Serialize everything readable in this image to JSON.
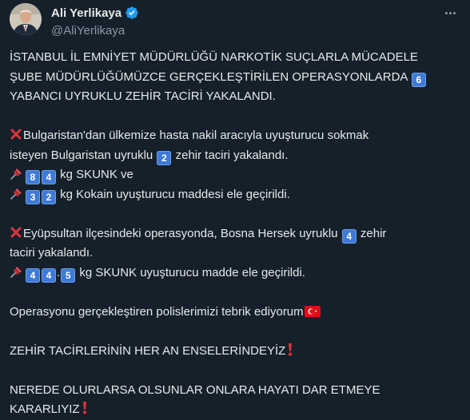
{
  "author": {
    "display_name": "Ali Yerlikaya",
    "handle": "@AliYerlikaya"
  },
  "icons": {
    "verified": "verified-badge-icon",
    "more": "more-options-icon",
    "x_mark": "red-cross-mark-icon",
    "pin": "pushpin-icon",
    "flag": "turkey-flag-icon",
    "exclamation": "red-exclamation-icon"
  },
  "colors": {
    "background": "#15202b",
    "text": "#e7e9ea",
    "muted": "#8b98a5",
    "verified": "#1d9bf0",
    "keycap": "#3f7ad6",
    "red": "#e0343a"
  },
  "tweet": {
    "p1": {
      "l1": "İSTANBUL İL EMNİYET MÜDÜRLÜĞÜ NARKOTİK SUÇLARLA MÜCADELE",
      "l2a": "ŞUBE MÜDÜRLÜĞÜMÜZCE GERÇEKLEŞTİRİLEN OPERASYONLARDA",
      "l2n": "6",
      "l3": "YABANCI UYRUKLU ZEHİR TACİRİ YAKALANDI."
    },
    "p2": {
      "l1": "Bulgaristan'dan ülkemize hasta nakil aracıyla uyuşturucu sokmak",
      "l2a": "isteyen Bulgaristan uyruklu",
      "l2n": "2",
      "l2b": "zehir taciri yakalandı.",
      "l3n1": "8",
      "l3n2": "4",
      "l3": "kg SKUNK ve",
      "l4n1": "3",
      "l4n2": "2",
      "l4": "kg Kokain uyuşturucu maddesi ele geçirildi."
    },
    "p3": {
      "l1a": "Eyüpsultan ilçesindeki operasyonda, Bosna Hersek uyruklu",
      "l1n": "4",
      "l1b": "zehir",
      "l2": "taciri yakalandı.",
      "l3n1": "4",
      "l3n2": "4",
      "l3dot": ".",
      "l3n3": "5",
      "l3": "kg SKUNK uyuşturucu madde ele geçirildi."
    },
    "p4": "Operasyonu gerçekleştiren polislerimizi tebrik ediyorum",
    "p5": "ZEHİR TACİRLERİNİN HER AN ENSELERİNDEYİZ",
    "p6": {
      "l1": "NEREDE OLURLARSA OLSUNLAR ONLARA HAYATI DAR ETMEYE",
      "l2": "KARARLIYIZ"
    }
  }
}
